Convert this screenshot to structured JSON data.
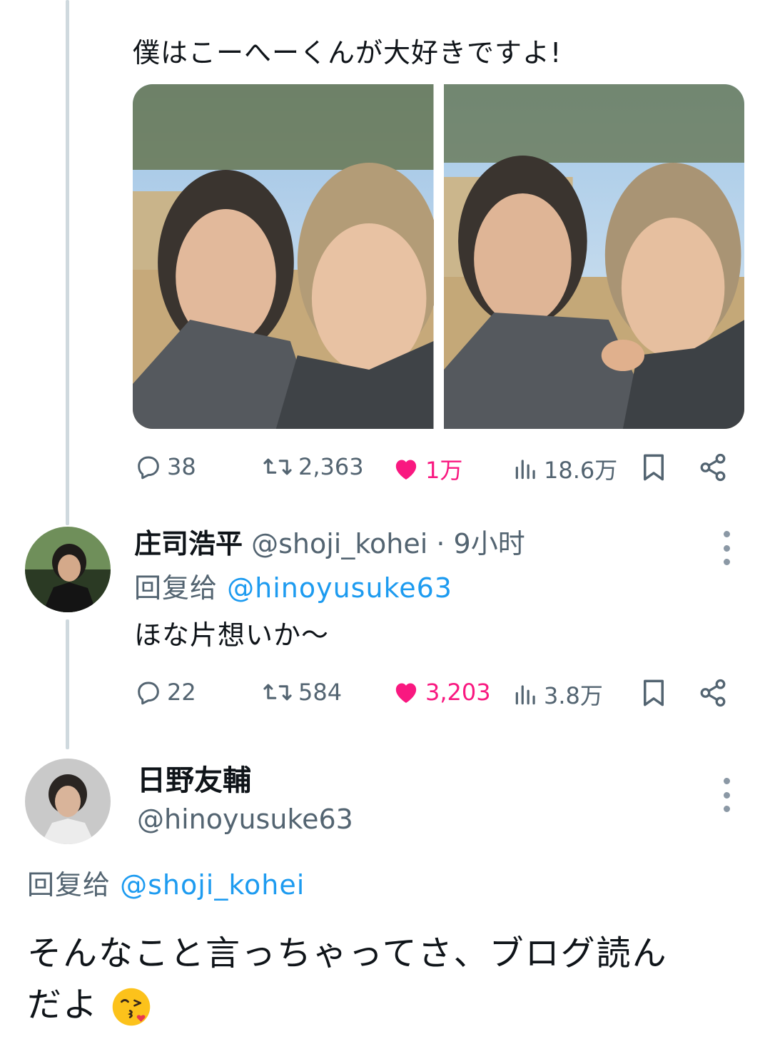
{
  "tweet1": {
    "text": "僕はこーへーくんが大好きですよ!",
    "stats": {
      "replies": "38",
      "retweets": "2,363",
      "likes": "1万",
      "views": "18.6万"
    }
  },
  "tweet2": {
    "display_name": "庄司浩平",
    "handle": "@shoji_kohei",
    "time": "· 9小时",
    "reply_prefix": "回复给",
    "reply_to": "@hinoyusuke63",
    "text": "ほな片想いか〜",
    "stats": {
      "replies": "22",
      "retweets": "584",
      "likes": "3,203",
      "views": "3.8万"
    }
  },
  "tweet3": {
    "display_name": "日野友輔",
    "handle": "@hinoyusuke63",
    "reply_prefix": "回复给",
    "reply_to": "@shoji_kohei",
    "text_line1": "そんなこと言っちゃってさ、ブログ読ん",
    "text_line2": "だよ"
  },
  "icons": [
    "reply-icon",
    "retweet-icon",
    "heart-icon",
    "views-icon",
    "bookmark-icon",
    "share-icon",
    "more-icon",
    "kiss-emoji"
  ],
  "colors": {
    "accent": "#1d9bf0",
    "like": "#f91880",
    "muted": "#536471",
    "line": "#cfd9de"
  }
}
